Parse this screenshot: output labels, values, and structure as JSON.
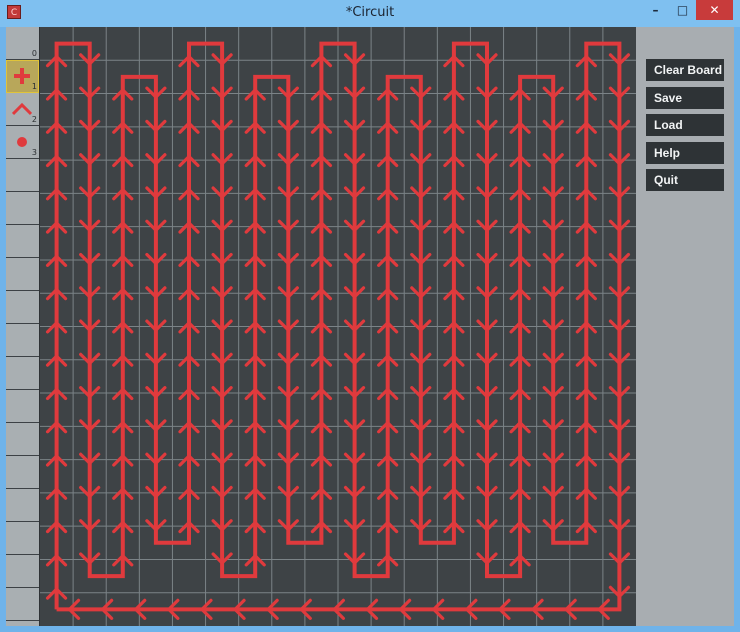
{
  "window": {
    "title": "*Circuit",
    "app_icon_glyph": "C",
    "minimize_glyph": "–",
    "maximize_glyph": "□",
    "close_glyph": "✕"
  },
  "toolbox": {
    "tools": [
      {
        "number": "0",
        "icon": "empty",
        "selected": false
      },
      {
        "number": "1",
        "icon": "cross-icon",
        "selected": true
      },
      {
        "number": "2",
        "icon": "curve-icon",
        "selected": false
      },
      {
        "number": "3",
        "icon": "dot-icon",
        "selected": false
      }
    ],
    "empty_slots": 14
  },
  "board": {
    "columns": 18,
    "rows": 18,
    "background_color": "#3e4346",
    "grid_color": "#7b8387",
    "wire_color": "#e03a3d",
    "wire": {
      "columns": [
        {
          "direction": "up",
          "from_row": 17,
          "to_row": 0
        },
        {
          "direction": "down",
          "from_row": 0,
          "to_row": 16
        },
        {
          "direction": "up",
          "from_row": 16,
          "to_row": 1
        },
        {
          "direction": "down",
          "from_row": 1,
          "to_row": 15
        },
        {
          "direction": "up",
          "from_row": 15,
          "to_row": 0
        },
        {
          "direction": "down",
          "from_row": 0,
          "to_row": 16
        },
        {
          "direction": "up",
          "from_row": 16,
          "to_row": 1
        },
        {
          "direction": "down",
          "from_row": 1,
          "to_row": 15
        },
        {
          "direction": "up",
          "from_row": 15,
          "to_row": 0
        },
        {
          "direction": "down",
          "from_row": 0,
          "to_row": 16
        },
        {
          "direction": "up",
          "from_row": 16,
          "to_row": 1
        },
        {
          "direction": "down",
          "from_row": 1,
          "to_row": 15
        },
        {
          "direction": "up",
          "from_row": 15,
          "to_row": 0
        },
        {
          "direction": "down",
          "from_row": 0,
          "to_row": 16
        },
        {
          "direction": "up",
          "from_row": 16,
          "to_row": 1
        },
        {
          "direction": "down",
          "from_row": 1,
          "to_row": 15
        },
        {
          "direction": "up",
          "from_row": 15,
          "to_row": 0
        },
        {
          "direction": "down",
          "from_row": 0,
          "to_row": 17
        }
      ],
      "bottom_return": {
        "row": 17,
        "direction": "left",
        "from_column": 17,
        "to_column": 0
      }
    }
  },
  "menu": {
    "buttons": [
      {
        "label": "Clear Board",
        "name": "clear-board-button"
      },
      {
        "label": "Save",
        "name": "save-button"
      },
      {
        "label": "Load",
        "name": "load-button"
      },
      {
        "label": "Help",
        "name": "help-button"
      },
      {
        "label": "Quit",
        "name": "quit-button"
      }
    ]
  }
}
